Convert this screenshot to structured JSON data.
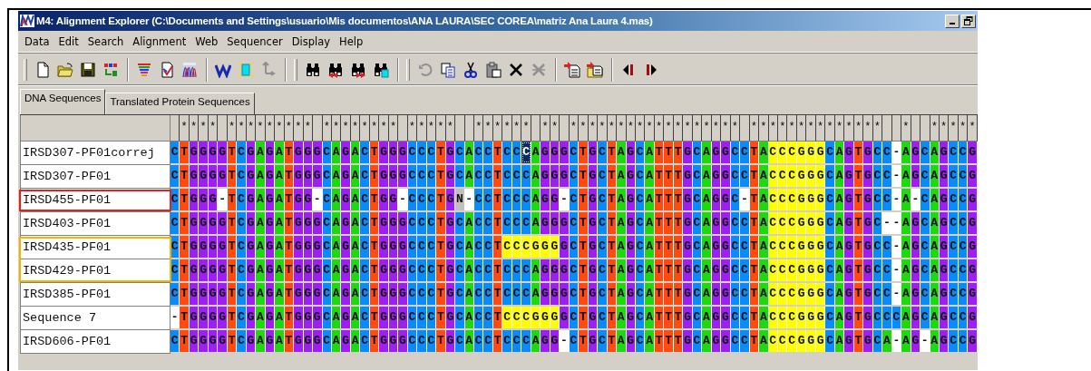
{
  "window": {
    "title": "M4: Alignment Explorer (C:\\Documents and Settings\\usuario\\Mis documentos\\ANA LAURA\\SEC COREA\\matriz Ana Laura 4.mas)"
  },
  "menu": [
    "Data",
    "Edit",
    "Search",
    "Alignment",
    "Web",
    "Sequencer",
    "Display",
    "Help"
  ],
  "tabs": [
    {
      "label": "DNA Sequences",
      "selected": true
    },
    {
      "label": "Translated Protein Sequences",
      "selected": false
    }
  ],
  "alignment": {
    "conservation": " **** ********* ******** *****  ****** ** ****************** **************  *  *****",
    "rows": [
      {
        "name": "IRSD307-PF01correj",
        "sequence": "CTGGGGTCGAGATGGGCAGACTGGGCCCTGCACCTCCCAGGGCTGCTAGCATTTGCAGGCCTACCCGGGCAGTGCC-AGCAGCCG",
        "highlighted": [
          false,
          false,
          false,
          false,
          false,
          false,
          false,
          false,
          false,
          false,
          false,
          false,
          false,
          false,
          false,
          false,
          false,
          false,
          false,
          false,
          false,
          false,
          false,
          false,
          false,
          false,
          false,
          false,
          false,
          false,
          false,
          false,
          false,
          false,
          false,
          false,
          false,
          false,
          false,
          false,
          false,
          false,
          false,
          false,
          false,
          false,
          false,
          false,
          false,
          false,
          false,
          false,
          false,
          false,
          false,
          false,
          false,
          false,
          false,
          false,
          false,
          false,
          false,
          true,
          true,
          true,
          true,
          true,
          true,
          false,
          false,
          false,
          false,
          false,
          false,
          false,
          false,
          false,
          false,
          false,
          false,
          false,
          false,
          false,
          false
        ],
        "selected": [
          false,
          false,
          false,
          false,
          false,
          false,
          false,
          false,
          false,
          false,
          false,
          false,
          false,
          false,
          false,
          false,
          false,
          false,
          false,
          false,
          false,
          false,
          false,
          false,
          false,
          false,
          false,
          false,
          false,
          false,
          false,
          false,
          false,
          false,
          false,
          false,
          false,
          true,
          false,
          false,
          false,
          false,
          false,
          false,
          false,
          false,
          false,
          false,
          false,
          false,
          false,
          false,
          false,
          false,
          false,
          false,
          false,
          false,
          false,
          false,
          false,
          false,
          false,
          false,
          false,
          false,
          false,
          false,
          false,
          false,
          false,
          false,
          false,
          false,
          false,
          false,
          false,
          false,
          false,
          false,
          false,
          false,
          false,
          false,
          false
        ]
      },
      {
        "name": "IRSD307-PF01",
        "sequence": "CTGGGGTCGAGATGGGCAGACTGGGCCCTGCACCTCCCAGGGCTGCTAGCATTTGCAGGCCTACCCGGGCAGTGCC-AGCAGCCG",
        "highlighted": [
          false,
          false,
          false,
          false,
          false,
          false,
          false,
          false,
          false,
          false,
          false,
          false,
          false,
          false,
          false,
          false,
          false,
          false,
          false,
          false,
          false,
          false,
          false,
          false,
          false,
          false,
          false,
          false,
          false,
          false,
          false,
          false,
          false,
          false,
          false,
          false,
          false,
          false,
          false,
          false,
          false,
          false,
          false,
          false,
          false,
          false,
          false,
          false,
          false,
          false,
          false,
          false,
          false,
          false,
          false,
          false,
          false,
          false,
          false,
          false,
          false,
          false,
          false,
          true,
          true,
          true,
          true,
          true,
          true,
          false,
          false,
          false,
          false,
          false,
          false,
          false,
          false,
          false,
          false,
          false,
          false,
          false,
          false,
          false,
          false
        ]
      },
      {
        "name": "IRSD455-PF01",
        "color": "#e8201a",
        "sequence": "CTGGG-TCGAGATGG-CAGACTGG-CCCTGN-CCTCCCAGG-CTGCTAGCATTTGCAGGC-TACCCGGGCAGTGCC-A-CAGCCG",
        "highlighted": [
          false,
          false,
          false,
          false,
          false,
          false,
          false,
          false,
          false,
          false,
          false,
          false,
          false,
          false,
          false,
          false,
          false,
          false,
          false,
          false,
          false,
          false,
          false,
          false,
          false,
          false,
          false,
          false,
          false,
          false,
          false,
          false,
          false,
          false,
          false,
          false,
          false,
          false,
          false,
          false,
          false,
          false,
          false,
          false,
          false,
          false,
          false,
          false,
          false,
          false,
          false,
          false,
          false,
          false,
          false,
          false,
          false,
          false,
          false,
          false,
          false,
          false,
          false,
          true,
          true,
          true,
          true,
          true,
          true,
          false,
          false,
          false,
          false,
          false,
          false,
          false,
          false,
          false,
          false,
          false,
          false,
          false,
          false,
          false,
          false
        ]
      },
      {
        "name": "IRSD403-PF01",
        "sequence": "CTGGGGTCGAGATGGGCAGACTGGGCCCTGCACCTCCCAGGGCTGCTAGCATTTGCAGGCCTACCCGGGCAGTGC--AGCAGCCG",
        "highlighted": [
          false,
          false,
          false,
          false,
          false,
          false,
          false,
          false,
          false,
          false,
          false,
          false,
          false,
          false,
          false,
          false,
          false,
          false,
          false,
          false,
          false,
          false,
          false,
          false,
          false,
          false,
          false,
          false,
          false,
          false,
          false,
          false,
          false,
          false,
          false,
          false,
          false,
          false,
          false,
          false,
          false,
          false,
          false,
          false,
          false,
          false,
          false,
          false,
          false,
          false,
          false,
          false,
          false,
          false,
          false,
          false,
          false,
          false,
          false,
          false,
          false,
          false,
          false,
          true,
          true,
          true,
          true,
          true,
          true,
          false,
          false,
          false,
          false,
          false,
          false,
          false,
          false,
          false,
          false,
          false,
          false,
          false,
          false,
          false,
          false
        ]
      },
      {
        "name": "IRSD435-PF01",
        "color": "#f5b301",
        "sequence": "CTGGGGTCGAGATGGGCAGACTGGGCCCTGCACCTCCCGGGGCTGCTAGCATTTGCAGGCCTACCCGGGCAGTGCC-AGCAGCCG",
        "highlighted": [
          false,
          false,
          false,
          false,
          false,
          false,
          false,
          false,
          false,
          false,
          false,
          false,
          false,
          false,
          false,
          false,
          false,
          false,
          false,
          false,
          false,
          false,
          false,
          false,
          false,
          false,
          false,
          false,
          false,
          false,
          false,
          false,
          false,
          false,
          false,
          true,
          true,
          true,
          true,
          true,
          true,
          false,
          false,
          false,
          false,
          false,
          false,
          false,
          false,
          false,
          false,
          false,
          false,
          false,
          false,
          false,
          false,
          false,
          false,
          false,
          false,
          false,
          false,
          true,
          true,
          true,
          true,
          true,
          true,
          false,
          false,
          false,
          false,
          false,
          false,
          false,
          false,
          false,
          false,
          false,
          false,
          false,
          false,
          false,
          false
        ]
      },
      {
        "name": "IRSD429-PF01",
        "color": "#f5b301",
        "sequence": "CTGGGGTCGAGATGGGCAGACTGGGCCCTGCACCTCCCAGGGCTGCTAGCATTTGCAGGCCTACCCGGGCAGTGCC-AGCAGCCG",
        "highlighted": [
          false,
          false,
          false,
          false,
          false,
          false,
          false,
          false,
          false,
          false,
          false,
          false,
          false,
          false,
          false,
          false,
          false,
          false,
          false,
          false,
          false,
          false,
          false,
          false,
          false,
          false,
          false,
          false,
          false,
          false,
          false,
          false,
          false,
          false,
          false,
          false,
          false,
          false,
          false,
          false,
          false,
          false,
          false,
          false,
          false,
          false,
          false,
          false,
          false,
          false,
          false,
          false,
          false,
          false,
          false,
          false,
          false,
          false,
          false,
          false,
          false,
          false,
          false,
          true,
          true,
          true,
          true,
          true,
          true,
          false,
          false,
          false,
          false,
          false,
          false,
          false,
          false,
          false,
          false,
          false,
          false,
          false,
          false,
          false,
          false
        ]
      },
      {
        "name": "IRSD385-PF01",
        "sequence": "CTGGGGTCGAGATGGGCAGACTGGGCCCTGCACCTCCCAGGGCTGCTAGCATTTGCAGGCCTACCCGGGCAGTGCC-AGCAGCCG",
        "highlighted": [
          false,
          false,
          false,
          false,
          false,
          false,
          false,
          false,
          false,
          false,
          false,
          false,
          false,
          false,
          false,
          false,
          false,
          false,
          false,
          false,
          false,
          false,
          false,
          false,
          false,
          false,
          false,
          false,
          false,
          false,
          false,
          false,
          false,
          false,
          false,
          false,
          false,
          false,
          false,
          false,
          false,
          false,
          false,
          false,
          false,
          false,
          false,
          false,
          false,
          false,
          false,
          false,
          false,
          false,
          false,
          false,
          false,
          false,
          false,
          false,
          false,
          false,
          false,
          true,
          true,
          true,
          true,
          true,
          true,
          false,
          false,
          false,
          false,
          false,
          false,
          false,
          false,
          false,
          false,
          false,
          false,
          false,
          false,
          false,
          false
        ]
      },
      {
        "name": "Sequence 7",
        "sequence": "-TGGGGTCGAGATGGGCAGACTGGGCCCTGCACCTCCCGGGGCTGCTAGCATTTGCAGGCCTACCCGGGCAGTGCCCAGCAGCCG",
        "highlighted": [
          false,
          false,
          false,
          false,
          false,
          false,
          false,
          false,
          false,
          false,
          false,
          false,
          false,
          false,
          false,
          false,
          false,
          false,
          false,
          false,
          false,
          false,
          false,
          false,
          false,
          false,
          false,
          false,
          false,
          false,
          false,
          false,
          false,
          false,
          false,
          true,
          true,
          true,
          true,
          true,
          true,
          false,
          false,
          false,
          false,
          false,
          false,
          false,
          false,
          false,
          false,
          false,
          false,
          false,
          false,
          false,
          false,
          false,
          false,
          false,
          false,
          false,
          false,
          true,
          true,
          true,
          true,
          true,
          true,
          false,
          false,
          false,
          false,
          false,
          false,
          false,
          false,
          false,
          false,
          false,
          false,
          false,
          false,
          false,
          false
        ]
      },
      {
        "name": "IRSD606-PF01",
        "sequence": "CTGGGGTCGAGATGGGCAGACTGGGCCCTGCACCTCCCAGG-CTGCTAGCATTTGCAGGCCTACCCGGGCAGTGCA-AG-AGCCG",
        "highlighted": [
          false,
          false,
          false,
          false,
          false,
          false,
          false,
          false,
          false,
          false,
          false,
          false,
          false,
          false,
          false,
          false,
          false,
          false,
          false,
          false,
          false,
          false,
          false,
          false,
          false,
          false,
          false,
          false,
          false,
          false,
          false,
          false,
          false,
          false,
          false,
          false,
          false,
          false,
          false,
          false,
          false,
          false,
          false,
          false,
          false,
          false,
          false,
          false,
          false,
          false,
          false,
          false,
          false,
          false,
          false,
          false,
          false,
          false,
          false,
          false,
          false,
          false,
          false,
          true,
          true,
          true,
          true,
          true,
          true,
          false,
          false,
          false,
          false,
          false,
          false,
          false,
          false,
          false,
          false,
          false,
          false,
          false,
          false,
          false,
          false
        ]
      }
    ]
  }
}
